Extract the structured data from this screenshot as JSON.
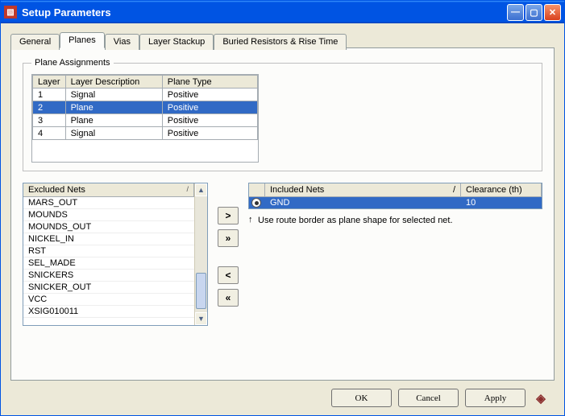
{
  "window": {
    "title": "Setup Parameters"
  },
  "tabs": {
    "general": "General",
    "planes": "Planes",
    "vias": "Vias",
    "layer_stackup": "Layer Stackup",
    "buried": "Buried Resistors & Rise Time"
  },
  "plane_assignments": {
    "legend": "Plane Assignments",
    "headers": {
      "layer": "Layer",
      "desc": "Layer Description",
      "type": "Plane Type"
    },
    "rows": [
      {
        "layer": "1",
        "desc": "Signal",
        "type": "Positive",
        "selected": false
      },
      {
        "layer": "2",
        "desc": "Plane",
        "type": "Positive",
        "selected": true
      },
      {
        "layer": "3",
        "desc": "Plane",
        "type": "Positive",
        "selected": false
      },
      {
        "layer": "4",
        "desc": "Signal",
        "type": "Positive",
        "selected": false
      }
    ]
  },
  "excluded": {
    "header": "Excluded Nets",
    "items": [
      "MARS_OUT",
      "MOUNDS",
      "MOUNDS_OUT",
      "NICKEL_IN",
      "RST",
      "SEL_MADE",
      "SNICKERS",
      "SNICKER_OUT",
      "VCC",
      "XSIG010011"
    ]
  },
  "move": {
    "right": ">",
    "right_all": "»",
    "left": "<",
    "left_all": "«"
  },
  "included": {
    "header_name": "Included Nets",
    "header_clearance": "Clearance (th)",
    "rows": [
      {
        "name": "GND",
        "clearance": "10",
        "selected": true,
        "radio": true
      }
    ]
  },
  "hint": "Use route border as plane shape for selected net.",
  "buttons": {
    "ok": "OK",
    "cancel": "Cancel",
    "apply": "Apply"
  }
}
